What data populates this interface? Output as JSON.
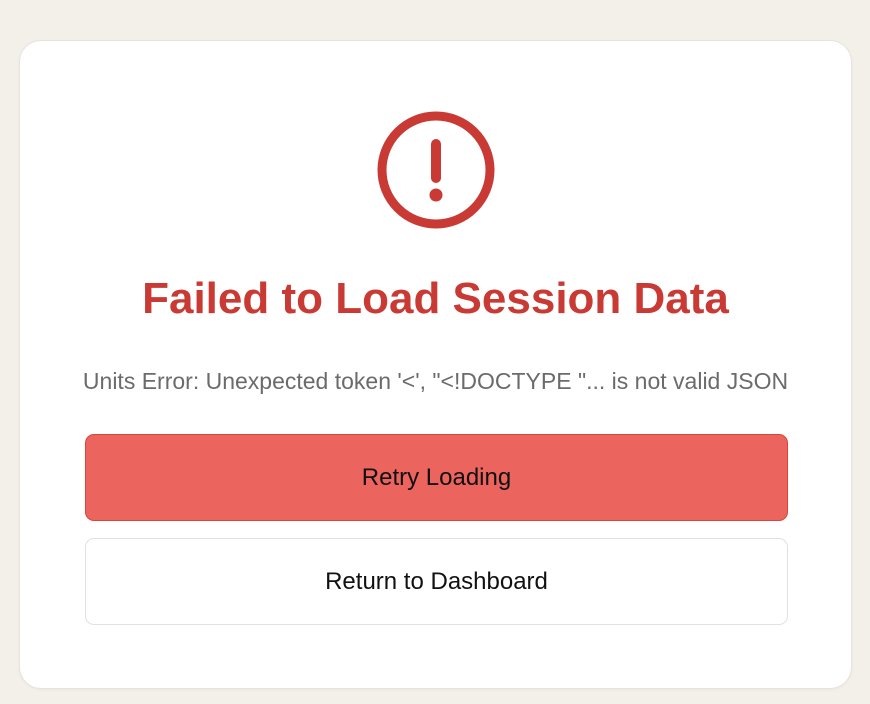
{
  "error": {
    "title": "Failed to Load Session Data",
    "message": "Units Error: Unexpected token '<', \"<!DOCTYPE \"... is not valid JSON",
    "icon": "exclamation-circle-icon",
    "accent_color": "#c93a34"
  },
  "actions": {
    "retry_label": "Retry Loading",
    "dashboard_label": "Return to Dashboard"
  }
}
